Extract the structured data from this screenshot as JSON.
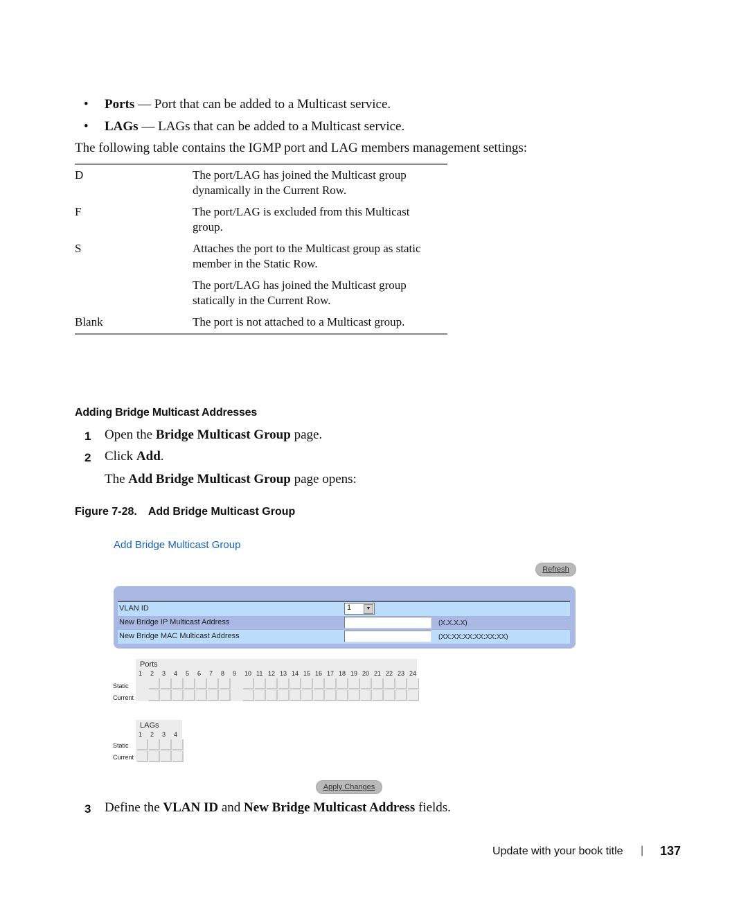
{
  "bullets": [
    {
      "term": "Ports",
      "text": " — Port that can be added to a Multicast service."
    },
    {
      "term": "LAGs",
      "text": " — LAGs that can be added to a Multicast service."
    }
  ],
  "intro": "The following table contains the IGMP port and LAG members management settings:",
  "legend_table": [
    {
      "key": "D",
      "desc": "The port/LAG has joined the Multicast group dynamically in the Current Row."
    },
    {
      "key": "F",
      "desc": "The port/LAG is excluded from this Multicast group."
    },
    {
      "key": "S",
      "desc": "Attaches the port to the Multicast group as static member in the Static Row."
    },
    {
      "key": "",
      "desc": "The port/LAG has joined the Multicast group statically in the Current Row."
    },
    {
      "key": "Blank",
      "desc": "The port is not attached to a Multicast group."
    }
  ],
  "section": {
    "heading": "Adding Bridge Multicast Addresses",
    "steps": [
      {
        "num": "1",
        "pre": "Open the ",
        "bold": "Bridge Multicast Group",
        "post": " page."
      },
      {
        "num": "2",
        "pre": "Click ",
        "bold": "Add",
        "post": "."
      }
    ],
    "opens": {
      "pre": "The ",
      "bold": "Add Bridge Multicast Group",
      "post": " page opens:"
    },
    "figure_num": "Figure 7-28.",
    "figure_title": "Add Bridge Multicast Group"
  },
  "ui": {
    "title": "Add Bridge Multicast Group",
    "refresh_label": "Refresh",
    "fields": [
      {
        "label": "VLAN ID",
        "type": "select",
        "value": "1",
        "hint": ""
      },
      {
        "label": "New Bridge IP Multicast Address",
        "type": "text",
        "value": "",
        "hint": "(X.X.X.X)"
      },
      {
        "label": "New Bridge MAC Multicast Address",
        "type": "text",
        "value": "",
        "hint": "(XX:XX:XX:XX:XX:XX)"
      }
    ],
    "ports": {
      "title": "Ports",
      "numbers": [
        "1",
        "2",
        "3",
        "4",
        "5",
        "6",
        "7",
        "8",
        "9",
        "10",
        "11",
        "12",
        "13",
        "14",
        "15",
        "16",
        "17",
        "18",
        "19",
        "20",
        "21",
        "22",
        "23",
        "24"
      ],
      "row_labels": [
        "Static",
        "Current"
      ]
    },
    "lags": {
      "title": "LAGs",
      "numbers": [
        "1",
        "2",
        "3",
        "4"
      ],
      "row_labels": [
        "Static",
        "Current"
      ]
    },
    "apply_label": "Apply Changes",
    "accent": "#1565c0",
    "panel_color": "#a9b9e3",
    "row_light": "#bbdcfb"
  },
  "step3": {
    "num": "3",
    "parts": [
      {
        "t": "Define the ",
        "b": false
      },
      {
        "t": "VLAN ID",
        "b": true
      },
      {
        "t": " and ",
        "b": false
      },
      {
        "t": "New Bridge Multicast Address",
        "b": true
      },
      {
        "t": " fields.",
        "b": false
      }
    ]
  },
  "footer": {
    "book_title": "Update with your book title",
    "separator": "|",
    "page_number": "137"
  }
}
